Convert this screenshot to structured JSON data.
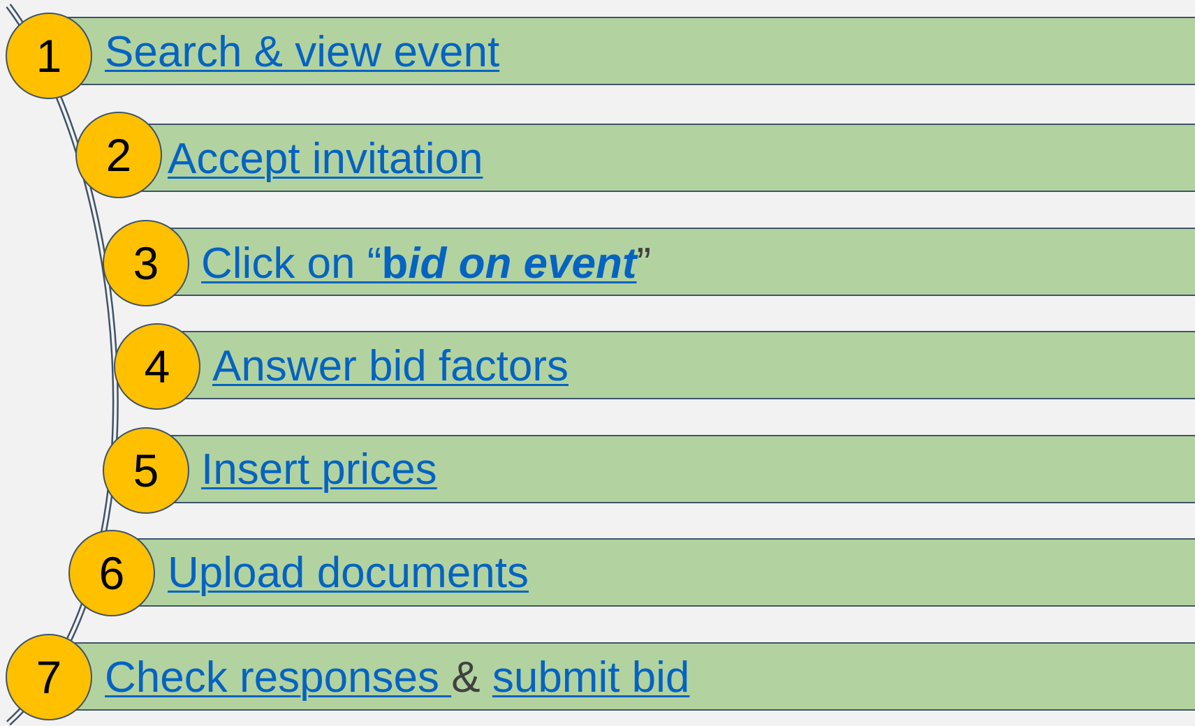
{
  "steps": [
    {
      "number": "1",
      "label": "Search & view event"
    },
    {
      "number": "2",
      "label": "Accept invitation"
    },
    {
      "number": "3",
      "label_parts": {
        "prefix": "Click on “",
        "bold": "b",
        "bold_italic": "id on event",
        "suffix": "”"
      }
    },
    {
      "number": "4",
      "label": "Answer bid factors"
    },
    {
      "number": "5",
      "label": "Insert prices"
    },
    {
      "number": "6",
      "label": "Upload documents"
    },
    {
      "number": "7",
      "label_parts": {
        "first": "Check responses ",
        "amp": "&",
        "second": "submit bid"
      }
    }
  ],
  "colors": {
    "background": "#f2f2f2",
    "bar_fill": "#b2d3a0",
    "bar_border": "#3f5368",
    "circle_fill": "#ffc000",
    "link_text": "#0563c1"
  }
}
